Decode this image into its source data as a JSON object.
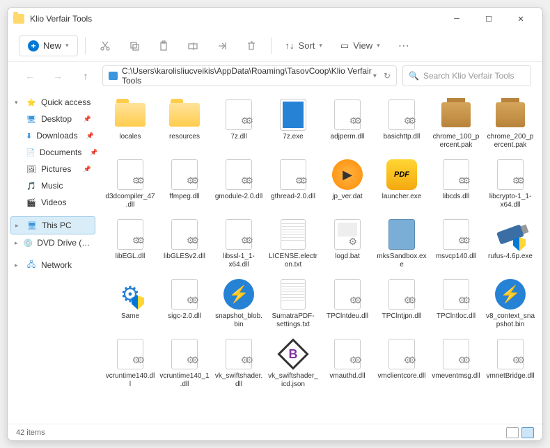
{
  "window": {
    "title": "Klio Verfair Tools"
  },
  "toolbar": {
    "new_label": "New",
    "sort_label": "Sort",
    "view_label": "View"
  },
  "address": {
    "path": "C:\\Users\\karolisliucveikis\\AppData\\Roaming\\TasovCoop\\Klio Verfair Tools"
  },
  "search": {
    "placeholder": "Search Klio Verfair Tools"
  },
  "sidebar": {
    "quick": "Quick access",
    "desktop": "Desktop",
    "downloads": "Downloads",
    "documents": "Documents",
    "pictures": "Pictures",
    "music": "Music",
    "videos": "Videos",
    "thispc": "This PC",
    "dvd": "DVD Drive (D:) CCCC",
    "network": "Network"
  },
  "files": [
    {
      "name": "locales",
      "type": "folder"
    },
    {
      "name": "resources",
      "type": "folder"
    },
    {
      "name": "7z.dll",
      "type": "dll"
    },
    {
      "name": "7z.exe",
      "type": "exe-blue"
    },
    {
      "name": "adjperm.dll",
      "type": "dll"
    },
    {
      "name": "basichttp.dll",
      "type": "dll"
    },
    {
      "name": "chrome_100_percent.pak",
      "type": "pak"
    },
    {
      "name": "chrome_200_percent.pak",
      "type": "pak"
    },
    {
      "name": "d3dcompiler_47.dll",
      "type": "dll"
    },
    {
      "name": "ffmpeg.dll",
      "type": "dll"
    },
    {
      "name": "gmodule-2.0.dll",
      "type": "dll"
    },
    {
      "name": "gthread-2.0.dll",
      "type": "dll"
    },
    {
      "name": "jp_ver.dat",
      "type": "play"
    },
    {
      "name": "launcher.exe",
      "type": "pdf"
    },
    {
      "name": "libcds.dll",
      "type": "dll"
    },
    {
      "name": "libcrypto-1_1-x64.dll",
      "type": "dll"
    },
    {
      "name": "libEGL.dll",
      "type": "dll"
    },
    {
      "name": "libGLESv2.dll",
      "type": "dll"
    },
    {
      "name": "libssl-1_1-x64.dll",
      "type": "dll"
    },
    {
      "name": "LICENSE.electron.txt",
      "type": "txt"
    },
    {
      "name": "logd.bat",
      "type": "bat"
    },
    {
      "name": "mksSandbox.exe",
      "type": "sandbox"
    },
    {
      "name": "msvcp140.dll",
      "type": "dll"
    },
    {
      "name": "rufus-4.6p.exe",
      "type": "usb"
    },
    {
      "name": "Same",
      "type": "gear-shield"
    },
    {
      "name": "sigc-2.0.dll",
      "type": "dll"
    },
    {
      "name": "snapshot_blob.bin",
      "type": "bolt"
    },
    {
      "name": "SumatraPDF-settings.txt",
      "type": "txt"
    },
    {
      "name": "TPClntdeu.dll",
      "type": "dll"
    },
    {
      "name": "TPClntjpn.dll",
      "type": "dll"
    },
    {
      "name": "TPClntloc.dll",
      "type": "dll"
    },
    {
      "name": "v8_context_snapshot.bin",
      "type": "bolt"
    },
    {
      "name": "vcruntime140.dll",
      "type": "dll"
    },
    {
      "name": "vcruntime140_1.dll",
      "type": "dll"
    },
    {
      "name": "vk_swiftshader.dll",
      "type": "dll"
    },
    {
      "name": "vk_swiftshader_icd.json",
      "type": "b"
    },
    {
      "name": "vmauthd.dll",
      "type": "dll"
    },
    {
      "name": "vmclientcore.dll",
      "type": "dll"
    },
    {
      "name": "vmeventmsg.dll",
      "type": "dll"
    },
    {
      "name": "vmnetBridge.dll",
      "type": "dll"
    }
  ],
  "status": {
    "count": "42 items"
  }
}
